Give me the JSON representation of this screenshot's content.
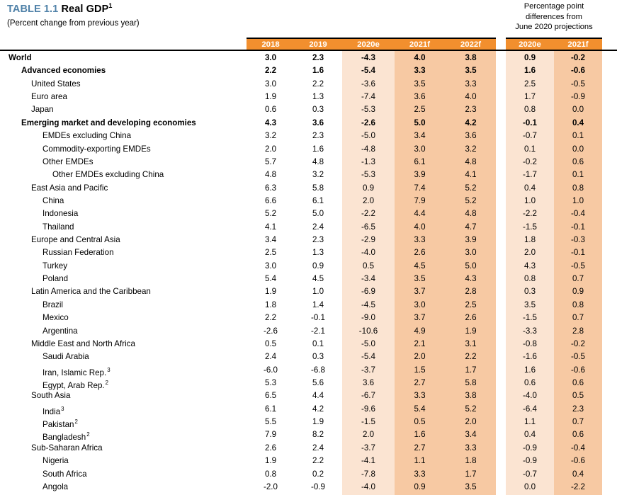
{
  "title": {
    "number": "TABLE 1.1",
    "name": "Real GDP",
    "superscript": "1",
    "subtitle": "(Percent change from previous year)"
  },
  "diff_header": {
    "line1": "Percentage point",
    "line2": "differences from",
    "line3": "June 2020 projections"
  },
  "colors": {
    "header_band": "#f28f2e",
    "shade_light": "#fbe4d2",
    "shade_dark": "#f7c9a3",
    "title_accent": "#4f81a8",
    "rule": "#000000"
  },
  "columns": {
    "main": [
      "2018",
      "2019",
      "2020e",
      "2021f",
      "2022f"
    ],
    "diff": [
      "2020e",
      "2021f"
    ]
  },
  "rows": [
    {
      "label": "World",
      "sup": "",
      "level": 0,
      "bold": true,
      "values": [
        "3.0",
        "2.3",
        "-4.3",
        "4.0",
        "3.8"
      ],
      "diff": [
        "0.9",
        "-0.2"
      ]
    },
    {
      "label": "Advanced economies",
      "sup": "",
      "level": 1,
      "bold": true,
      "values": [
        "2.2",
        "1.6",
        "-5.4",
        "3.3",
        "3.5"
      ],
      "diff": [
        "1.6",
        "-0.6"
      ]
    },
    {
      "label": "United States",
      "sup": "",
      "level": 2,
      "bold": false,
      "values": [
        "3.0",
        "2.2",
        "-3.6",
        "3.5",
        "3.3"
      ],
      "diff": [
        "2.5",
        "-0.5"
      ]
    },
    {
      "label": "Euro area",
      "sup": "",
      "level": 2,
      "bold": false,
      "values": [
        "1.9",
        "1.3",
        "-7.4",
        "3.6",
        "4.0"
      ],
      "diff": [
        "1.7",
        "-0.9"
      ]
    },
    {
      "label": "Japan",
      "sup": "",
      "level": 2,
      "bold": false,
      "values": [
        "0.6",
        "0.3",
        "-5.3",
        "2.5",
        "2.3"
      ],
      "diff": [
        "0.8",
        "0.0"
      ]
    },
    {
      "label": "Emerging market and developing economies",
      "sup": "",
      "level": 1,
      "bold": true,
      "values": [
        "4.3",
        "3.6",
        "-2.6",
        "5.0",
        "4.2"
      ],
      "diff": [
        "-0.1",
        "0.4"
      ]
    },
    {
      "label": "EMDEs excluding China",
      "sup": "",
      "level": 3,
      "bold": false,
      "values": [
        "3.2",
        "2.3",
        "-5.0",
        "3.4",
        "3.6"
      ],
      "diff": [
        "-0.7",
        "0.1"
      ]
    },
    {
      "label": "Commodity-exporting EMDEs",
      "sup": "",
      "level": 3,
      "bold": false,
      "values": [
        "2.0",
        "1.6",
        "-4.8",
        "3.0",
        "3.2"
      ],
      "diff": [
        "0.1",
        "0.0"
      ]
    },
    {
      "label": "Other EMDEs",
      "sup": "",
      "level": 3,
      "bold": false,
      "values": [
        "5.7",
        "4.8",
        "-1.3",
        "6.1",
        "4.8"
      ],
      "diff": [
        "-0.2",
        "0.6"
      ]
    },
    {
      "label": "Other EMDEs excluding China",
      "sup": "",
      "level": 4,
      "bold": false,
      "values": [
        "4.8",
        "3.2",
        "-5.3",
        "3.9",
        "4.1"
      ],
      "diff": [
        "-1.7",
        "0.1"
      ]
    },
    {
      "label": "East Asia and Pacific",
      "sup": "",
      "level": 2,
      "bold": false,
      "values": [
        "6.3",
        "5.8",
        "0.9",
        "7.4",
        "5.2"
      ],
      "diff": [
        "0.4",
        "0.8"
      ]
    },
    {
      "label": "China",
      "sup": "",
      "level": 3,
      "bold": false,
      "values": [
        "6.6",
        "6.1",
        "2.0",
        "7.9",
        "5.2"
      ],
      "diff": [
        "1.0",
        "1.0"
      ]
    },
    {
      "label": "Indonesia",
      "sup": "",
      "level": 3,
      "bold": false,
      "values": [
        "5.2",
        "5.0",
        "-2.2",
        "4.4",
        "4.8"
      ],
      "diff": [
        "-2.2",
        "-0.4"
      ]
    },
    {
      "label": "Thailand",
      "sup": "",
      "level": 3,
      "bold": false,
      "values": [
        "4.1",
        "2.4",
        "-6.5",
        "4.0",
        "4.7"
      ],
      "diff": [
        "-1.5",
        "-0.1"
      ]
    },
    {
      "label": "Europe and Central Asia",
      "sup": "",
      "level": 2,
      "bold": false,
      "values": [
        "3.4",
        "2.3",
        "-2.9",
        "3.3",
        "3.9"
      ],
      "diff": [
        "1.8",
        "-0.3"
      ]
    },
    {
      "label": "Russian Federation",
      "sup": "",
      "level": 3,
      "bold": false,
      "values": [
        "2.5",
        "1.3",
        "-4.0",
        "2.6",
        "3.0"
      ],
      "diff": [
        "2.0",
        "-0.1"
      ]
    },
    {
      "label": "Turkey",
      "sup": "",
      "level": 3,
      "bold": false,
      "values": [
        "3.0",
        "0.9",
        "0.5",
        "4.5",
        "5.0"
      ],
      "diff": [
        "4.3",
        "-0.5"
      ]
    },
    {
      "label": "Poland",
      "sup": "",
      "level": 3,
      "bold": false,
      "values": [
        "5.4",
        "4.5",
        "-3.4",
        "3.5",
        "4.3"
      ],
      "diff": [
        "0.8",
        "0.7"
      ]
    },
    {
      "label": "Latin America and the Caribbean",
      "sup": "",
      "level": 2,
      "bold": false,
      "values": [
        "1.9",
        "1.0",
        "-6.9",
        "3.7",
        "2.8"
      ],
      "diff": [
        "0.3",
        "0.9"
      ]
    },
    {
      "label": "Brazil",
      "sup": "",
      "level": 3,
      "bold": false,
      "values": [
        "1.8",
        "1.4",
        "-4.5",
        "3.0",
        "2.5"
      ],
      "diff": [
        "3.5",
        "0.8"
      ]
    },
    {
      "label": "Mexico",
      "sup": "",
      "level": 3,
      "bold": false,
      "values": [
        "2.2",
        "-0.1",
        "-9.0",
        "3.7",
        "2.6"
      ],
      "diff": [
        "-1.5",
        "0.7"
      ]
    },
    {
      "label": "Argentina",
      "sup": "",
      "level": 3,
      "bold": false,
      "values": [
        "-2.6",
        "-2.1",
        "-10.6",
        "4.9",
        "1.9"
      ],
      "diff": [
        "-3.3",
        "2.8"
      ]
    },
    {
      "label": "Middle East and North Africa",
      "sup": "",
      "level": 2,
      "bold": false,
      "values": [
        "0.5",
        "0.1",
        "-5.0",
        "2.1",
        "3.1"
      ],
      "diff": [
        "-0.8",
        "-0.2"
      ]
    },
    {
      "label": "Saudi Arabia",
      "sup": "",
      "level": 3,
      "bold": false,
      "values": [
        "2.4",
        "0.3",
        "-5.4",
        "2.0",
        "2.2"
      ],
      "diff": [
        "-1.6",
        "-0.5"
      ]
    },
    {
      "label": "Iran, Islamic Rep.",
      "sup": "3",
      "level": 3,
      "bold": false,
      "values": [
        "-6.0",
        "-6.8",
        "-3.7",
        "1.5",
        "1.7"
      ],
      "diff": [
        "1.6",
        "-0.6"
      ]
    },
    {
      "label": "Egypt, Arab Rep.",
      "sup": "2",
      "level": 3,
      "bold": false,
      "values": [
        "5.3",
        "5.6",
        "3.6",
        "2.7",
        "5.8"
      ],
      "diff": [
        "0.6",
        "0.6"
      ]
    },
    {
      "label": "South Asia",
      "sup": "",
      "level": 2,
      "bold": false,
      "values": [
        "6.5",
        "4.4",
        "-6.7",
        "3.3",
        "3.8"
      ],
      "diff": [
        "-4.0",
        "0.5"
      ]
    },
    {
      "label": "India",
      "sup": "3",
      "level": 3,
      "bold": false,
      "values": [
        "6.1",
        "4.2",
        "-9.6",
        "5.4",
        "5.2"
      ],
      "diff": [
        "-6.4",
        "2.3"
      ]
    },
    {
      "label": "Pakistan",
      "sup": "2",
      "level": 3,
      "bold": false,
      "values": [
        "5.5",
        "1.9",
        "-1.5",
        "0.5",
        "2.0"
      ],
      "diff": [
        "1.1",
        "0.7"
      ]
    },
    {
      "label": "Bangladesh",
      "sup": "2",
      "level": 3,
      "bold": false,
      "values": [
        "7.9",
        "8.2",
        "2.0",
        "1.6",
        "3.4"
      ],
      "diff": [
        "0.4",
        "0.6"
      ]
    },
    {
      "label": "Sub-Saharan Africa",
      "sup": "",
      "level": 2,
      "bold": false,
      "values": [
        "2.6",
        "2.4",
        "-3.7",
        "2.7",
        "3.3"
      ],
      "diff": [
        "-0.9",
        "-0.4"
      ]
    },
    {
      "label": "Nigeria",
      "sup": "",
      "level": 3,
      "bold": false,
      "values": [
        "1.9",
        "2.2",
        "-4.1",
        "1.1",
        "1.8"
      ],
      "diff": [
        "-0.9",
        "-0.6"
      ]
    },
    {
      "label": "South Africa",
      "sup": "",
      "level": 3,
      "bold": false,
      "values": [
        "0.8",
        "0.2",
        "-7.8",
        "3.3",
        "1.7"
      ],
      "diff": [
        "-0.7",
        "0.4"
      ]
    },
    {
      "label": "Angola",
      "sup": "",
      "level": 3,
      "bold": false,
      "values": [
        "-2.0",
        "-0.9",
        "-4.0",
        "0.9",
        "3.5"
      ],
      "diff": [
        "0.0",
        "-2.2"
      ]
    }
  ]
}
